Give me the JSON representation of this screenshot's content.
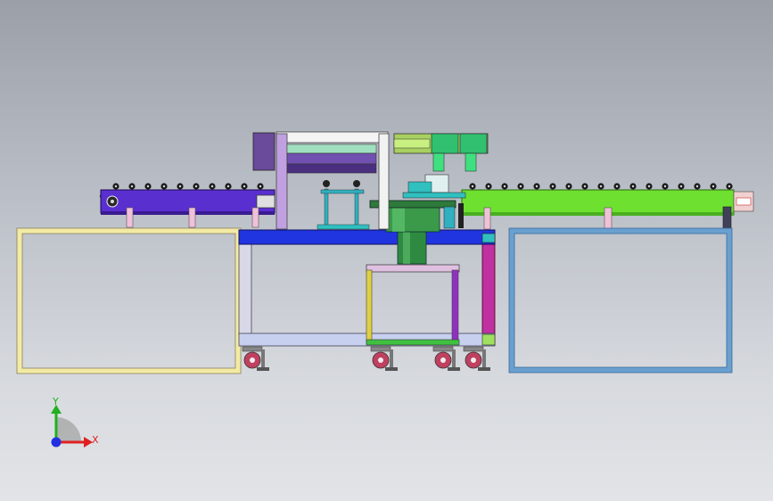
{
  "triad": {
    "x_label": "X",
    "y_label": "Y",
    "x_color": "#e02020",
    "y_color": "#20b020",
    "z_color": "#2030e0"
  },
  "colors": {
    "left_conveyor": "#5a2fd0",
    "right_conveyor": "#6ee030",
    "left_frame": "#f3eaa4",
    "right_frame": "#6aa0d0",
    "table_top": "#2035e0",
    "stand": "#c030a0",
    "bowl": "#3a9a4a",
    "gantry": "#c0a0e0"
  }
}
